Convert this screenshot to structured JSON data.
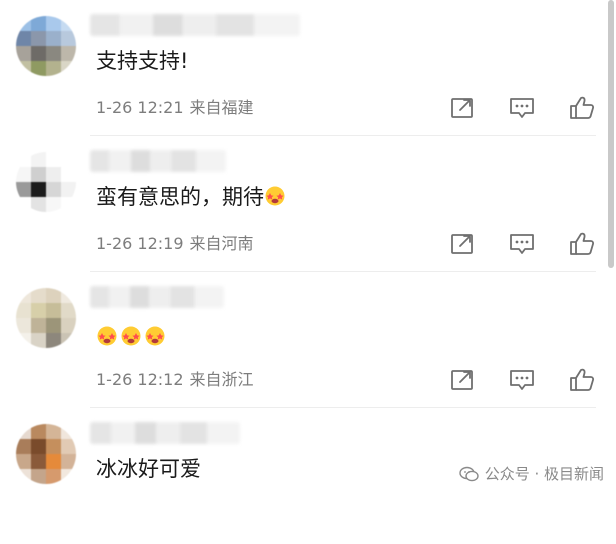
{
  "comments": [
    {
      "text": "支持支持!",
      "time": "1-26 12:21",
      "location": "来自福建",
      "emojis": 0
    },
    {
      "text": "蛮有意思的，期待",
      "time": "1-26 12:19",
      "location": "来自河南",
      "emojis": 1
    },
    {
      "text": "",
      "time": "1-26 12:12",
      "location": "来自浙江",
      "emojis": 3
    },
    {
      "text": "冰冰好可爱",
      "time": "",
      "location": "",
      "emojis": 0
    }
  ],
  "watermark": {
    "text": "公众号 · 极目新闻"
  },
  "icons": {
    "share": "share-icon",
    "reply": "comment-icon",
    "like": "thumbs-up-icon",
    "emoji": "starry-eyed-emoji-icon"
  }
}
